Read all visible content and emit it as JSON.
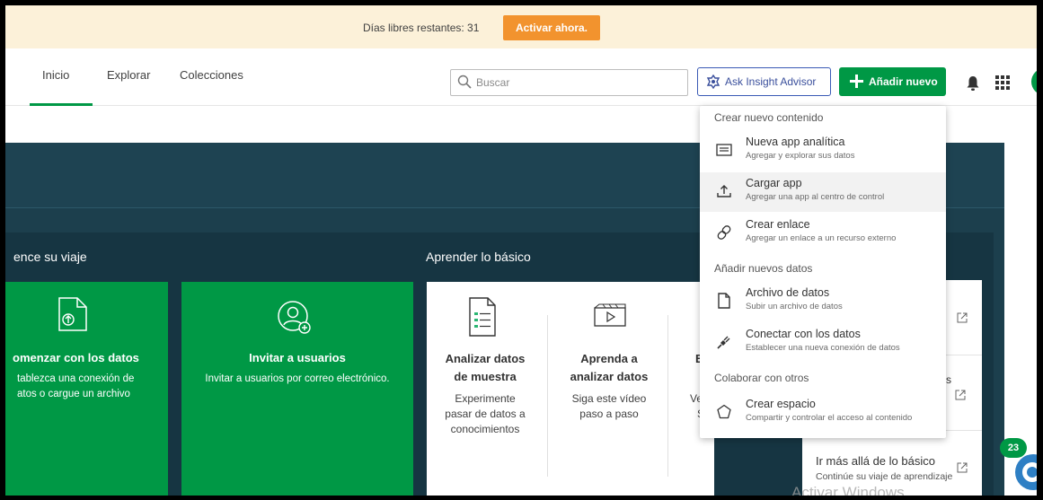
{
  "banner": {
    "text": "Días libres restantes: 31",
    "activate_label": "Activar ahora."
  },
  "nav": {
    "tabs": [
      "Inicio",
      "Explorar",
      "Colecciones"
    ],
    "active_tab": "Inicio"
  },
  "search": {
    "placeholder": "Buscar",
    "value": ""
  },
  "header": {
    "insight_label": "Ask Insight Advisor",
    "add_label": "Añadir nuevo"
  },
  "colors": {
    "accent_green": "#009845",
    "banner_bg": "#fcf1d9",
    "activate_orange": "#f2932e",
    "hero_dark": "#1c3f4d",
    "insight_blue": "#3a4f9c"
  },
  "hero": {
    "journey_title": "ence su viaje",
    "learn_title": "Aprender lo básico",
    "cards": {
      "comenzar": {
        "heading": "omenzar con los datos",
        "line1": "tablezca una conexión de",
        "line2": "atos o cargue un archivo"
      },
      "invitar": {
        "heading": "Invitar a usuarios",
        "body": "Invitar a usuarios por correo electrónico."
      }
    },
    "learn": {
      "analizar": {
        "heading1": "Analizar datos",
        "heading2": "de muestra",
        "body1": "Experimente",
        "body2": "pasar de datos a",
        "body3": "conocimientos"
      },
      "aprenda": {
        "heading1": "Aprenda a",
        "heading2": "analizar datos",
        "body1": "Siga este vídeo",
        "body2": "paso a paso"
      },
      "third": {
        "heading1": "E",
        "body1": "Ve",
        "body2": "S"
      }
    },
    "right_panel": {
      "frag1": "s",
      "frag2": "u",
      "item_title": "Ir más allá de lo básico",
      "item_sub": "Continúe su viaje de aprendizaje"
    }
  },
  "chat": {
    "badge": "23"
  },
  "watermark": "Activar Windows",
  "dropdown": {
    "sections": [
      "Crear nuevo contenido",
      "Añadir nuevos datos",
      "Colaborar con otros"
    ],
    "items": [
      {
        "title": "Nueva app analítica",
        "sub": "Agregar y explorar sus datos",
        "icon": "sheet-icon"
      },
      {
        "title": "Cargar app",
        "sub": "Agregar una app al centro de control",
        "icon": "upload-icon"
      },
      {
        "title": "Crear enlace",
        "sub": "Agregar un enlace a un recurso externo",
        "icon": "link-icon"
      },
      {
        "title": "Archivo de datos",
        "sub": "Subir un archivo de datos",
        "icon": "file-icon"
      },
      {
        "title": "Conectar con los datos",
        "sub": "Establecer una nueva conexión de datos",
        "icon": "plug-icon"
      },
      {
        "title": "Crear espacio",
        "sub": "Compartir y controlar el acceso al contenido",
        "icon": "space-icon"
      }
    ]
  }
}
